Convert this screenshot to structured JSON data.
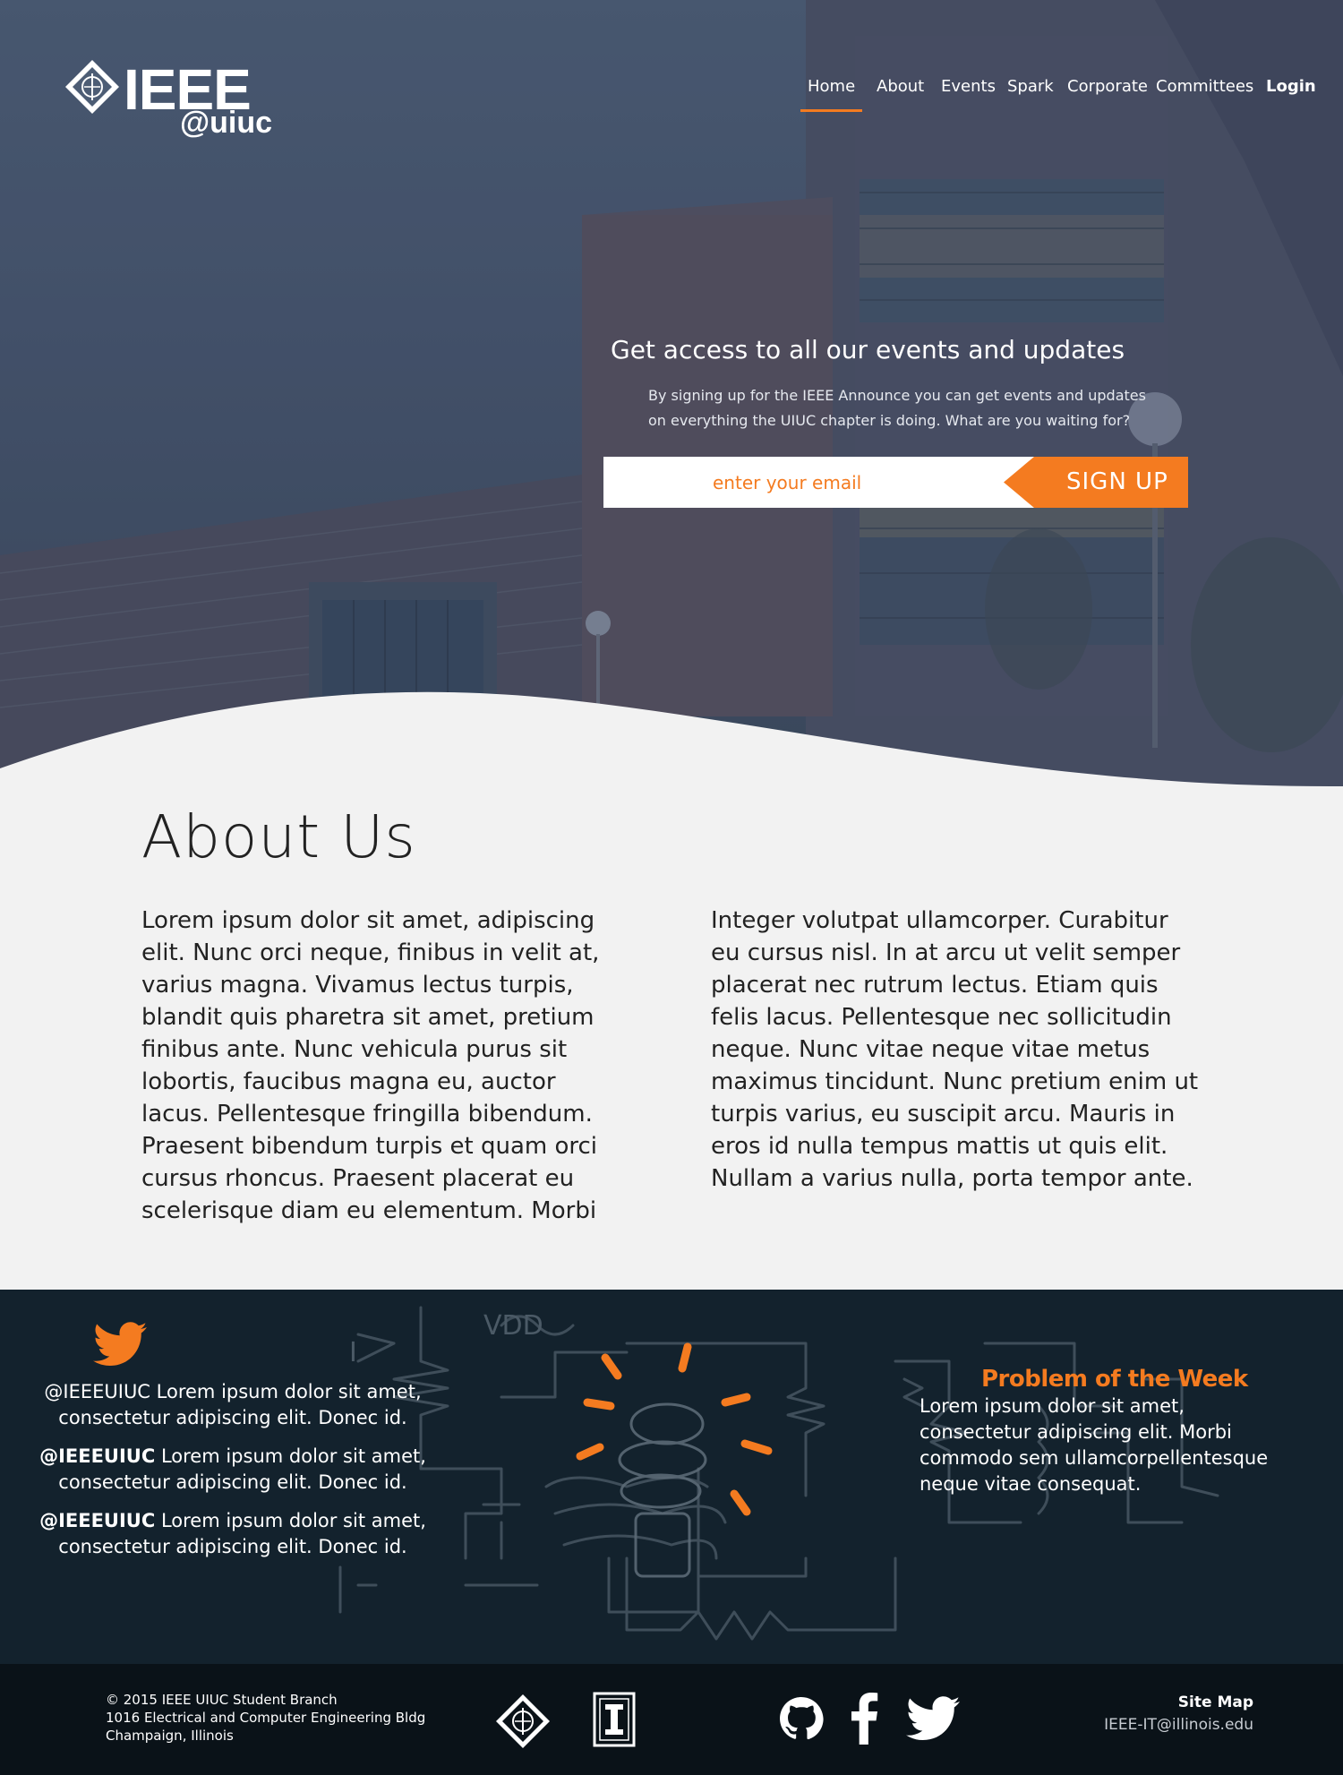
{
  "logo": {
    "main": "IEEE",
    "sub": "@uiuc"
  },
  "nav": {
    "items": [
      {
        "label": "Home",
        "active": true
      },
      {
        "label": "About"
      },
      {
        "label": "Events"
      },
      {
        "label": "Spark"
      },
      {
        "label": "Corporate"
      },
      {
        "label": "Committees"
      },
      {
        "label": "Login",
        "bold": true
      }
    ],
    "active_color": "#f47b20"
  },
  "hero": {
    "title": "Get access to all our events and updates",
    "subtitle_line1": "By signing up for the IEEE Announce you can get events and updates",
    "subtitle_line2": "on everything the UIUC chapter is doing. What are you waiting for?",
    "email_placeholder": "enter your email",
    "signup_label": "SIGN UP"
  },
  "about": {
    "title": "About Us",
    "col_left": "Lorem ipsum dolor sit amet, adipiscing elit. Nunc orci neque, finibus in velit at, varius magna. Vivamus lectus turpis, blandit quis pharetra sit amet, pretium finibus ante. Nunc vehicula purus sit lobortis, faucibus magna eu, auctor lacus. Pellentesque fringilla bibendum. Praesent bibendum turpis et quam orci cursus rhoncus. Praesent placerat eu scelerisque diam eu elementum. Morbi",
    "col_right": "Integer volutpat ullamcorper. Curabitur eu cursus nisl. In at arcu ut velit semper placerat nec rutrum lectus. Etiam quis felis lacus. Pellentesque nec sollicitudin neque. Nunc vitae neque vitae metus maximus tincidunt. Nunc pretium enim ut turpis varius, eu suscipit arcu. Mauris in eros id nulla tempus mattis ut quis elit. Nullam a varius nulla, porta tempor ante."
  },
  "twitter": {
    "icon": "twitter-bird-icon",
    "tweets": [
      {
        "handle": "@IEEEUIUC",
        "text": " Lorem ipsum dolor sit amet,",
        "line2": "consectetur adipiscing elit. Donec id."
      },
      {
        "handle": "@IEEEUIUC",
        "text": " Lorem ipsum dolor sit amet,",
        "line2": "consectetur adipiscing elit. Donec id."
      },
      {
        "handle": "@IEEEUIUC",
        "text": " Lorem ipsum dolor sit amet,",
        "line2": "consectetur adipiscing elit. Donec id."
      }
    ]
  },
  "potw": {
    "title": "Problem of the Week",
    "text": "Lorem ipsum dolor sit amet, consectetur adipiscing elit. Morbi commodo sem ullamcorpellentesque neque vitae consequat."
  },
  "footer": {
    "copyright": "© 2015 IEEE UIUC Student Branch",
    "address1": "1016 Electrical and Computer Engineering Bldg",
    "address2": "Champaign, Illinois",
    "sitemap": "Site Map",
    "email": "IEEE-IT@illinois.edu",
    "icons": [
      "ieee-logo-icon",
      "illinois-logo-icon",
      "github-icon",
      "facebook-icon",
      "twitter-icon"
    ]
  },
  "colors": {
    "accent": "#f47b20",
    "band": "#13222d",
    "footer": "#0a1218",
    "page": "#f2f2f2"
  }
}
